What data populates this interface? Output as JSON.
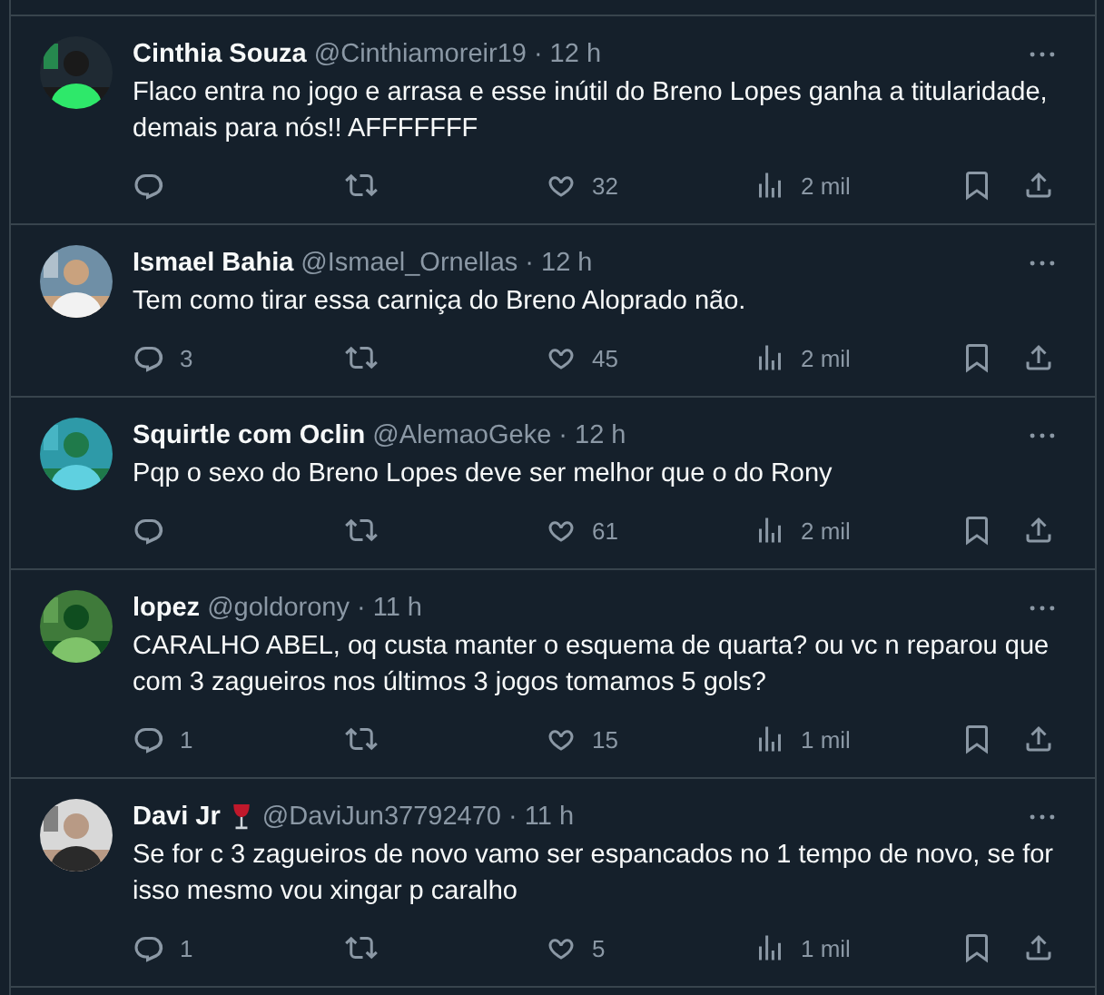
{
  "tweets": [
    {
      "name": "Cinthia Souza",
      "handle": "@Cinthiamoreir19",
      "time": "· 12 h",
      "text": "Flaco entra no jogo e arrasa e esse inútil do Breno Lopes ganha a titularidade, demais para nós!! AFFFFFFF",
      "likes": "32",
      "views": "2 mil"
    },
    {
      "name": "Ismael Bahia",
      "handle": "@Ismael_Ornellas",
      "time": "· 12 h",
      "text": "Tem como tirar essa carniça do Breno Aloprado não.",
      "replies": "3",
      "likes": "45",
      "views": "2 mil"
    },
    {
      "name": "Squirtle com Oclin",
      "handle": "@AlemaoGeke",
      "time": "· 12 h",
      "text": "Pqp o sexo do Breno Lopes deve ser melhor que o do Rony",
      "likes": "61",
      "views": "2 mil"
    },
    {
      "name": "lopez",
      "handle": "@goldorony",
      "time": "· 11 h",
      "text": "CARALHO ABEL, oq custa manter o esquema de quarta? ou vc n reparou que com 3 zagueiros nos últimos 3 jogos tomamos 5 gols?",
      "replies": "1",
      "likes": "15",
      "views": "1 mil"
    },
    {
      "name": "Davi Jr",
      "has_emoji": true,
      "handle": "@DaviJun37792470",
      "time": "· 11 h",
      "text": "Se for c 3 zagueiros de novo vamo ser espancados no 1 tempo de novo, se for isso mesmo vou xingar p caralho",
      "replies": "1",
      "likes": "5",
      "views": "1 mil"
    }
  ]
}
